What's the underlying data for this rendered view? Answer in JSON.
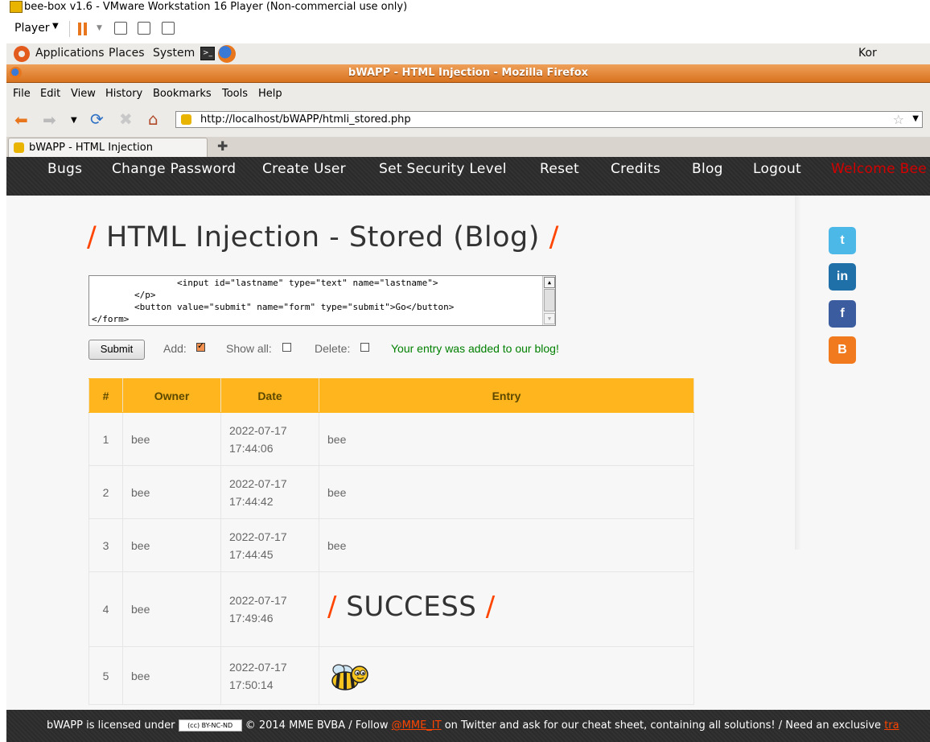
{
  "vmware": {
    "title": "bee-box v1.6 - VMware Workstation 16 Player (Non-commercial use only)",
    "player_menu": "Player"
  },
  "gnome_panel": {
    "applications": "Applications",
    "places": "Places",
    "system": "System",
    "keyboard_layout": "Kor"
  },
  "firefox": {
    "window_title": "bWAPP - HTML Injection - Mozilla Firefox",
    "menu": [
      "File",
      "Edit",
      "View",
      "History",
      "Bookmarks",
      "Tools",
      "Help"
    ],
    "url": "http://localhost/bWAPP/htmli_stored.php",
    "tab_title": "bWAPP - HTML Injection",
    "new_tab_symbol": "✚"
  },
  "site_nav": {
    "items": [
      "Bugs",
      "Change Password",
      "Create User",
      "Set Security Level",
      "Reset",
      "Credits",
      "Blog",
      "Logout"
    ],
    "welcome": "Welcome Bee"
  },
  "page": {
    "title": "HTML Injection - Stored (Blog)",
    "title_slash": "/",
    "textarea_value": "                <input id=\"lastname\" type=\"text\" name=\"lastname\">\n        </p>\n        <button value=\"submit\" name=\"form\" type=\"submit\">Go</button>\n</form>"
  },
  "form": {
    "submit_label": "Submit",
    "add_label": "Add:",
    "add_checked": true,
    "show_all_label": "Show all:",
    "show_all_checked": false,
    "delete_label": "Delete:",
    "delete_checked": false,
    "status_message": "Your entry was added to our blog!"
  },
  "table": {
    "headers": [
      "#",
      "Owner",
      "Date",
      "Entry"
    ],
    "rows": [
      {
        "num": "1",
        "owner": "bee",
        "date": "2022-07-17",
        "time": "17:44:06",
        "entry": "bee"
      },
      {
        "num": "2",
        "owner": "bee",
        "date": "2022-07-17",
        "time": "17:44:42",
        "entry": "bee"
      },
      {
        "num": "3",
        "owner": "bee",
        "date": "2022-07-17",
        "time": "17:44:45",
        "entry": "bee"
      },
      {
        "num": "4",
        "owner": "bee",
        "date": "2022-07-17",
        "time": "17:49:46",
        "entry_html_text": "SUCCESS"
      },
      {
        "num": "5",
        "owner": "bee",
        "date": "2022-07-17",
        "time": "17:50:14",
        "entry_image": "bee-image"
      }
    ]
  },
  "social": [
    {
      "name": "twitter",
      "glyph": "t",
      "color": "#4cb8e8"
    },
    {
      "name": "linkedin",
      "glyph": "in",
      "color": "#1f6fa8"
    },
    {
      "name": "facebook",
      "glyph": "f",
      "color": "#3b5c9e"
    },
    {
      "name": "blogger",
      "glyph": "B",
      "color": "#f27a1e"
    }
  ],
  "footer": {
    "licensed": "bWAPP is licensed under",
    "cc_badge": "(cc) BY-NC-ND",
    "copyright": "© 2014 MME BVBA / Follow",
    "twitter_handle": "@MME_IT",
    "rest": "on Twitter and ask for our cheat sheet, containing all solutions! / Need an exclusive",
    "trailing_link": "tra"
  }
}
